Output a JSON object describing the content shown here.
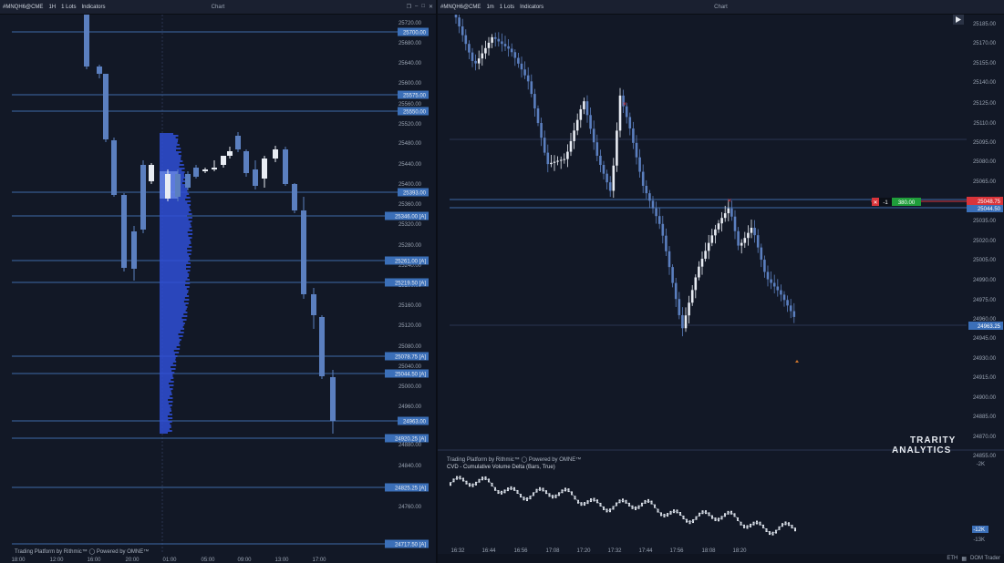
{
  "left": {
    "symbol": "#MNQH6@CME",
    "timeframe": "1H",
    "lots": "1 Lots",
    "indicators": "Indicators",
    "title": "Chart",
    "price_axis": [
      "25720.00",
      "25680.00",
      "25640.00",
      "25600.00",
      "25560.00",
      "25520.00",
      "25480.00",
      "25440.00",
      "25400.00",
      "25360.00",
      "25320.00",
      "25280.00",
      "25240.00",
      "25200.00",
      "25160.00",
      "25120.00",
      "25080.00",
      "25040.00",
      "25000.00",
      "24960.00",
      "24880.00",
      "24840.00",
      "24800.00",
      "24760.00"
    ],
    "level_tags": [
      "25700.00",
      "25575.00",
      "25550.00",
      "25393.00",
      "25346.00 [A]",
      "25261.00 [A]",
      "25219.50 [A]",
      "25078.75 [A]",
      "25044.50 [A]",
      "24963.00",
      "24920.25 [A]",
      "24825.25 [A]",
      "24717.50 [A]"
    ],
    "time_axis": [
      "18:00",
      "12:00",
      "16:00",
      "20:00",
      "01:00",
      "05:00",
      "09:00",
      "13:00",
      "17:00"
    ],
    "powered": "Trading Platform by Rithmic™  ◯ Powered by OMNE™"
  },
  "right": {
    "symbol": "#MNQH6@CME",
    "timeframe": "1m",
    "lots": "1 Lots",
    "indicators": "Indicators",
    "title": "Chart",
    "price_axis": [
      "25185.00",
      "25170.00",
      "25155.00",
      "25140.00",
      "25125.00",
      "25110.00",
      "25095.00",
      "25080.00",
      "25065.00",
      "25035.00",
      "25020.00",
      "25005.00",
      "24990.00",
      "24975.00",
      "24960.00",
      "24945.00",
      "24930.00",
      "24915.00",
      "24900.00",
      "24885.00",
      "24870.00",
      "24855.00"
    ],
    "position_qty": "-1",
    "position_pnl": "380.00",
    "entry_price": "25048.75",
    "price_tag_2": "25044.50",
    "last_price": "24963.25",
    "time_axis": [
      "16:32",
      "16:44",
      "16:56",
      "17:08",
      "17:20",
      "17:32",
      "17:44",
      "17:56",
      "18:08",
      "18:20"
    ],
    "powered": "Trading Platform by Rithmic™  ◯ Powered by OMNE™",
    "cvd_label": "CVD - Cumulative Volume Delta (Bars, True)",
    "cvd_axis": [
      "-2K",
      "-12K",
      "-13K"
    ],
    "logo_line1": "TRARITY",
    "logo_line2": "ANALYTICS",
    "footer": [
      "ETH",
      "DOM Trader"
    ]
  },
  "colors": {
    "bg": "#121826",
    "bear": "#5b7fbf",
    "bull": "#e8ecf3",
    "level": "#3d6aa8",
    "tag": "#3b6fb8",
    "profile": "#2f4fd6",
    "short": "#d8343a",
    "pnl": "#1f9d3a"
  }
}
